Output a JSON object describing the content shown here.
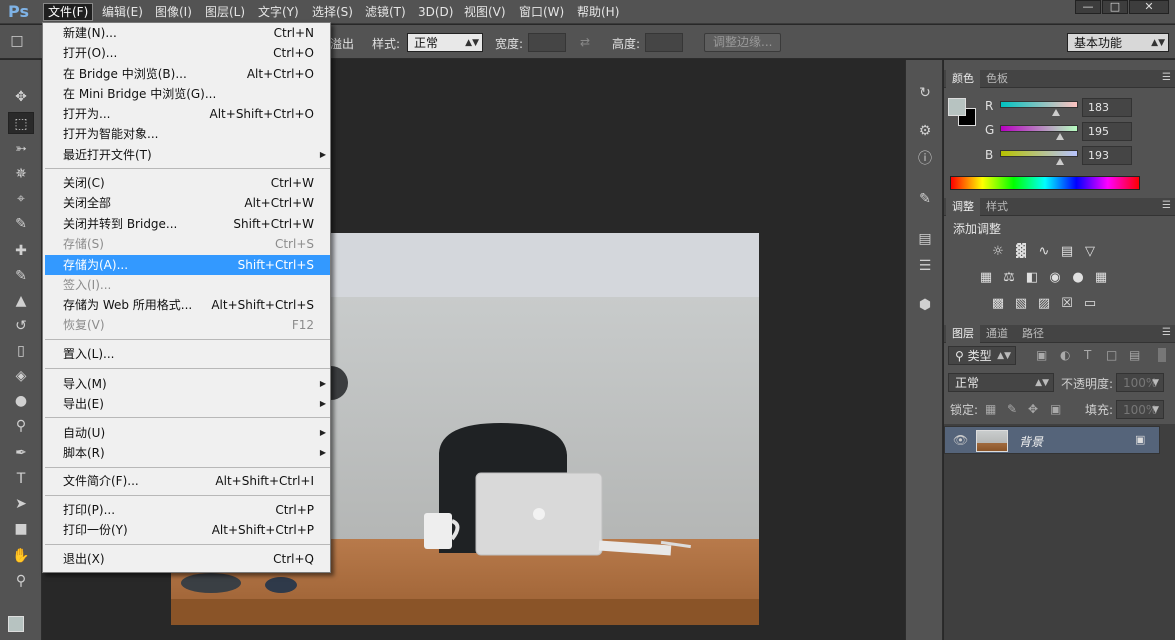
{
  "app": {
    "logo": "Ps"
  },
  "menubar": {
    "items": [
      {
        "label": "文件(F)"
      },
      {
        "label": "编辑(E)"
      },
      {
        "label": "图像(I)"
      },
      {
        "label": "图层(L)"
      },
      {
        "label": "文字(Y)"
      },
      {
        "label": "选择(S)"
      },
      {
        "label": "滤镜(T)"
      },
      {
        "label": "3D(D)"
      },
      {
        "label": "视图(V)"
      },
      {
        "label": "窗口(W)"
      },
      {
        "label": "帮助(H)"
      }
    ]
  },
  "options": {
    "feather_partial": "溢出",
    "style_label": "样式:",
    "style_value": "正常",
    "width_label": "宽度:",
    "height_label": "高度:",
    "refine_edge": "调整边缘...",
    "workspace": "基本功能"
  },
  "file_menu": {
    "items": [
      {
        "label": "新建(N)...",
        "shortcut": "Ctrl+N"
      },
      {
        "label": "打开(O)...",
        "shortcut": "Ctrl+O"
      },
      {
        "label": "在 Bridge 中浏览(B)...",
        "shortcut": "Alt+Ctrl+O"
      },
      {
        "label": "在 Mini Bridge 中浏览(G)...",
        "shortcut": ""
      },
      {
        "label": "打开为...",
        "shortcut": "Alt+Shift+Ctrl+O"
      },
      {
        "label": "打开为智能对象...",
        "shortcut": ""
      },
      {
        "label": "最近打开文件(T)",
        "shortcut": ""
      },
      {
        "label": "关闭(C)",
        "shortcut": "Ctrl+W"
      },
      {
        "label": "关闭全部",
        "shortcut": "Alt+Ctrl+W"
      },
      {
        "label": "关闭并转到 Bridge...",
        "shortcut": "Shift+Ctrl+W"
      },
      {
        "label": "存储(S)",
        "shortcut": "Ctrl+S"
      },
      {
        "label": "存储为(A)...",
        "shortcut": "Shift+Ctrl+S"
      },
      {
        "label": "签入(I)...",
        "shortcut": ""
      },
      {
        "label": "存储为 Web 所用格式...",
        "shortcut": "Alt+Shift+Ctrl+S"
      },
      {
        "label": "恢复(V)",
        "shortcut": "F12"
      },
      {
        "label": "置入(L)...",
        "shortcut": ""
      },
      {
        "label": "导入(M)",
        "shortcut": ""
      },
      {
        "label": "导出(E)",
        "shortcut": ""
      },
      {
        "label": "自动(U)",
        "shortcut": ""
      },
      {
        "label": "脚本(R)",
        "shortcut": ""
      },
      {
        "label": "文件简介(F)...",
        "shortcut": "Alt+Shift+Ctrl+I"
      },
      {
        "label": "打印(P)...",
        "shortcut": "Ctrl+P"
      },
      {
        "label": "打印一份(Y)",
        "shortcut": "Alt+Shift+Ctrl+P"
      },
      {
        "label": "退出(X)",
        "shortcut": "Ctrl+Q"
      }
    ]
  },
  "color_panel": {
    "tab_color": "颜色",
    "tab_swatches": "色板",
    "r_label": "R",
    "r_value": "183",
    "g_label": "G",
    "g_value": "195",
    "b_label": "B",
    "b_value": "193",
    "foreground": "#b7c3c1"
  },
  "adjust_panel": {
    "tab_adjust": "调整",
    "tab_styles": "样式",
    "title": "添加调整"
  },
  "layers_panel": {
    "tab_layers": "图层",
    "tab_channels": "通道",
    "tab_paths": "路径",
    "filter_kind": "类型",
    "blend_mode": "正常",
    "opacity_label": "不透明度:",
    "opacity_value": "100%",
    "lock_label": "锁定:",
    "fill_label": "填充:",
    "fill_value": "100%",
    "layer_name": "背景"
  }
}
